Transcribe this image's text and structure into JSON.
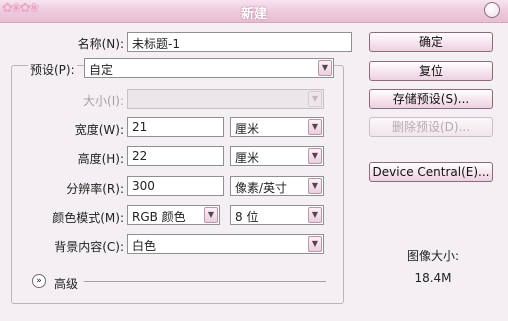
{
  "window": {
    "title": "新建"
  },
  "form": {
    "name_label": "名称(N):",
    "name_value": "未标题-1",
    "preset_label": "预设(P):",
    "preset_value": "自定",
    "size_label": "大小(I):",
    "size_value": "",
    "width_label": "宽度(W):",
    "width_value": "21",
    "width_unit": "厘米",
    "height_label": "高度(H):",
    "height_value": "22",
    "height_unit": "厘米",
    "resolution_label": "分辨率(R):",
    "resolution_value": "300",
    "resolution_unit": "像素/英寸",
    "color_mode_label": "颜色模式(M):",
    "color_mode_value": "RGB 颜色",
    "bit_depth_value": "8 位",
    "background_label": "背景内容(C):",
    "background_value": "白色",
    "advanced_label": "高级"
  },
  "buttons": {
    "ok": "确定",
    "reset": "复位",
    "save_preset": "存储预设(S)...",
    "delete_preset": "删除预设(D)...",
    "device_central": "Device Central(E)..."
  },
  "info": {
    "image_size_label": "图像大小:",
    "image_size_value": "18.4M"
  },
  "icons": {
    "dropdown": "chevron-down-icon",
    "advanced": "double-chevron-icon",
    "close": "close-icon"
  },
  "colors": {
    "titlebar": "#edc9db",
    "background": "#f4eff3",
    "button_border": "#8c6b7d"
  }
}
